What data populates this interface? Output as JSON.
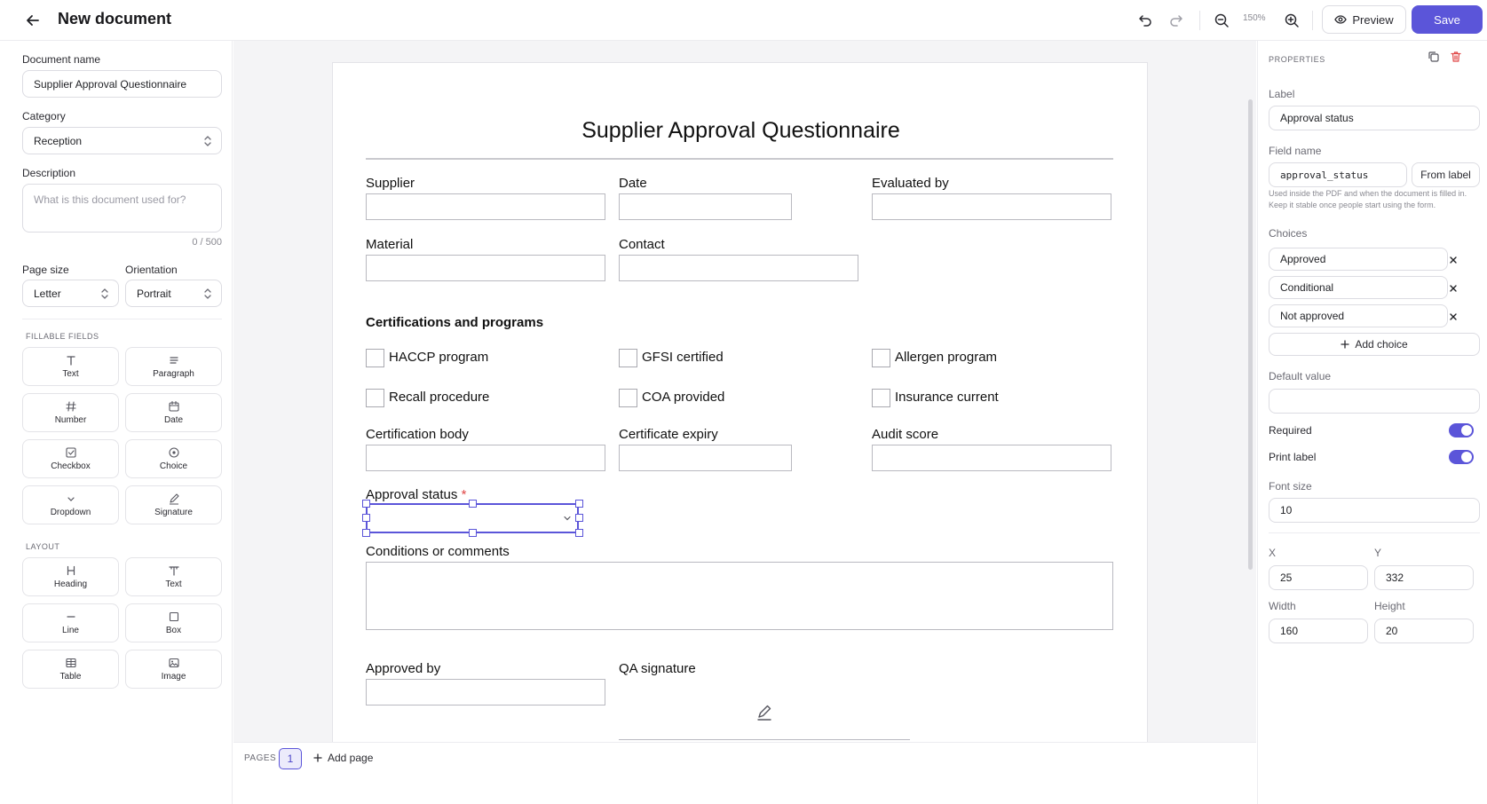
{
  "header": {
    "title": "New document",
    "zoom": "150%",
    "preview_label": "Preview",
    "save_label": "Save"
  },
  "sidebar": {
    "document_name_label": "Document name",
    "document_name_value": "Supplier Approval Questionnaire",
    "category_label": "Category",
    "category_value": "Reception",
    "description_label": "Description",
    "description_placeholder": "What is this document used for?",
    "description_count": "0 / 500",
    "page_size_label": "Page size",
    "page_size_value": "Letter",
    "orientation_label": "Orientation",
    "orientation_value": "Portrait",
    "fillable_title": "FILLABLE FIELDS",
    "fillable": [
      {
        "label": "Text",
        "icon": "text-icon"
      },
      {
        "label": "Paragraph",
        "icon": "paragraph-icon"
      },
      {
        "label": "Number",
        "icon": "hash-icon"
      },
      {
        "label": "Date",
        "icon": "calendar-icon"
      },
      {
        "label": "Checkbox",
        "icon": "checkbox-icon"
      },
      {
        "label": "Choice",
        "icon": "radio-icon"
      },
      {
        "label": "Dropdown",
        "icon": "chevron-down-icon"
      },
      {
        "label": "Signature",
        "icon": "pen-icon"
      }
    ],
    "layout_title": "LAYOUT",
    "layout": [
      {
        "label": "Heading",
        "icon": "heading-icon"
      },
      {
        "label": "Text",
        "icon": "text-block-icon"
      },
      {
        "label": "Line",
        "icon": "line-icon"
      },
      {
        "label": "Box",
        "icon": "box-icon"
      },
      {
        "label": "Table",
        "icon": "table-icon"
      },
      {
        "label": "Image",
        "icon": "image-icon"
      }
    ]
  },
  "doc": {
    "title": "Supplier Approval Questionnaire",
    "fields": {
      "supplier": "Supplier",
      "date": "Date",
      "evaluated_by": "Evaluated by",
      "material": "Material",
      "contact": "Contact",
      "cert_body": "Certification body",
      "cert_expiry": "Certificate expiry",
      "audit_score": "Audit score",
      "approval_status": "Approval status",
      "conditions": "Conditions or comments",
      "approved_by": "Approved by",
      "qa_signature": "QA signature"
    },
    "section_title": "Certifications and programs",
    "checkboxes": [
      "HACCP program",
      "GFSI certified",
      "Allergen program",
      "Recall procedure",
      "COA provided",
      "Insurance current"
    ],
    "required_mark": "*"
  },
  "pages_bar": {
    "label": "PAGES",
    "current": "1",
    "add_label": "Add page"
  },
  "properties": {
    "title": "PROPERTIES",
    "label_label": "Label",
    "label_value": "Approval status",
    "field_name_label": "Field name",
    "field_name_value": "approval_status",
    "from_label": "From label",
    "hint": "Used inside the PDF and when the document is filled in. Keep it stable once people start using the form.",
    "choices_label": "Choices",
    "choices": [
      "Approved",
      "Conditional",
      "Not approved"
    ],
    "add_choice": "Add choice",
    "default_label": "Default value",
    "default_value": "",
    "required_label": "Required",
    "required": true,
    "print_label_label": "Print label",
    "print_label": true,
    "font_size_label": "Font size",
    "font_size": "10",
    "x_label": "X",
    "x_value": "25",
    "y_label": "Y",
    "y_value": "332",
    "width_label": "Width",
    "width_value": "160",
    "height_label": "Height",
    "height_value": "20"
  },
  "colors": {
    "accent": "#5b55d9",
    "required": "#e04848",
    "delete": "#e04848"
  }
}
